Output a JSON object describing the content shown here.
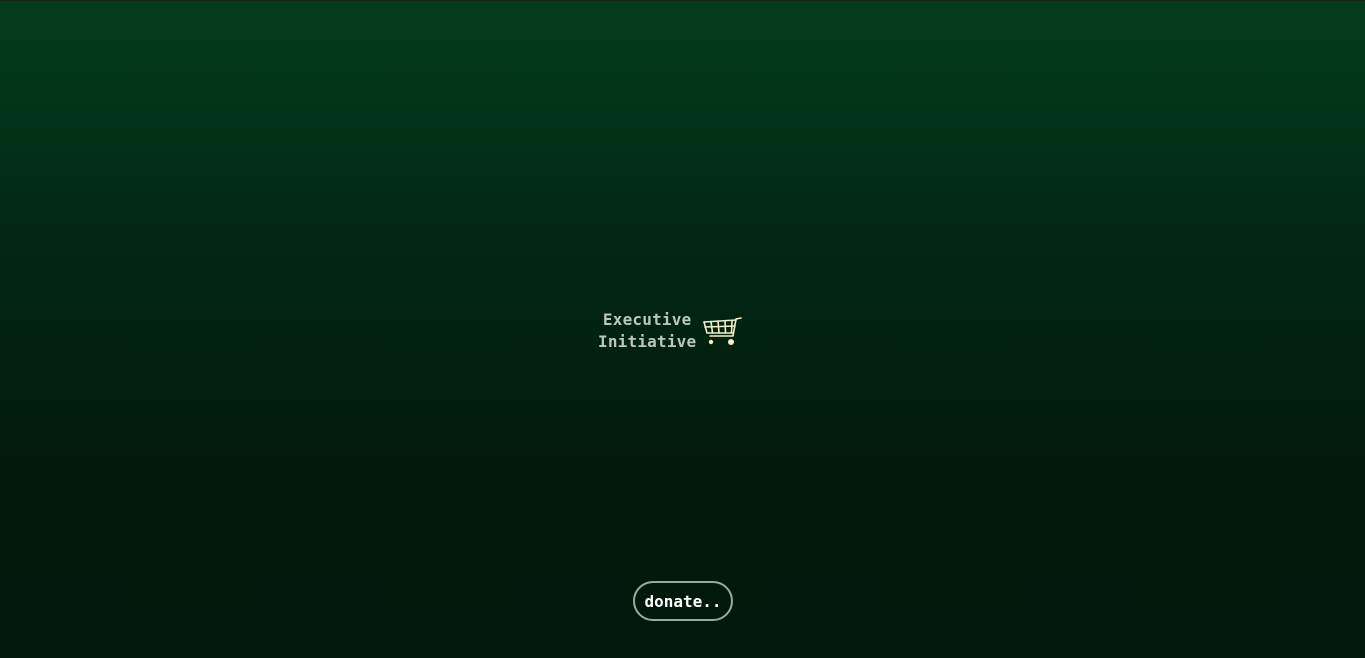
{
  "logo": {
    "line1": "Executive",
    "line2": "Initiative",
    "icon": "shopping-cart-icon"
  },
  "donate": {
    "label": "donate.."
  },
  "colors": {
    "background_top": "#033d1a",
    "background_bottom": "#01190c",
    "logo_text": "#b9c7bd",
    "cart_icon": "#f3eec7",
    "button_border": "#9aa89d",
    "button_text": "#ffffff"
  }
}
